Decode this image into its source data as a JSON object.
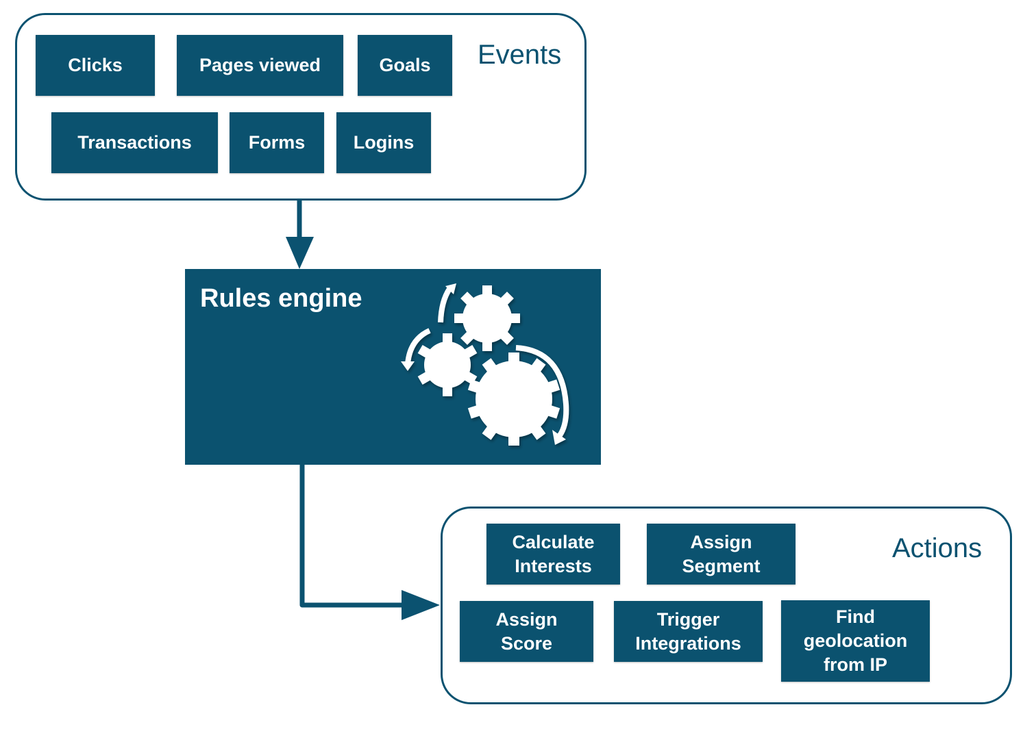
{
  "colors": {
    "primary": "#0b526f",
    "background": "#ffffff",
    "text_on_primary": "#ffffff"
  },
  "events": {
    "title": "Events",
    "items": [
      {
        "label": "Clicks"
      },
      {
        "label": "Pages viewed"
      },
      {
        "label": "Goals"
      },
      {
        "label": "Transactions"
      },
      {
        "label": "Forms"
      },
      {
        "label": "Logins"
      }
    ]
  },
  "engine": {
    "title": "Rules engine",
    "icon": "gears-icon"
  },
  "actions": {
    "title": "Actions",
    "items": [
      {
        "label": "Calculate\nInterests"
      },
      {
        "label": "Assign\nSegment"
      },
      {
        "label": "Assign\nScore"
      },
      {
        "label": "Trigger\nIntegrations"
      },
      {
        "label": "Find\ngeolocation\nfrom IP"
      }
    ]
  }
}
